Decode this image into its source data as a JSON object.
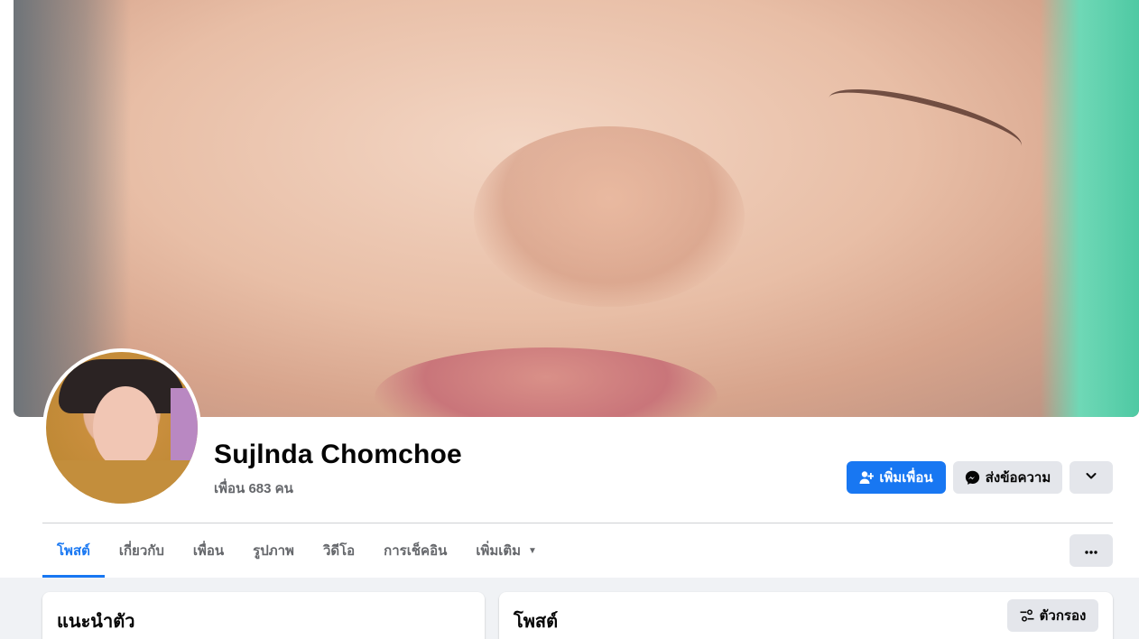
{
  "profile": {
    "name": "Sujlnda Chomchoe",
    "friends_count": "เพื่อน 683 คน"
  },
  "actions": {
    "add_friend": "เพิ่มเพื่อน",
    "message": "ส่งข้อความ"
  },
  "tabs": [
    {
      "label": "โพสต์",
      "active": true
    },
    {
      "label": "เกี่ยวกับ"
    },
    {
      "label": "เพื่อน"
    },
    {
      "label": "รูปภาพ"
    },
    {
      "label": "วิดีโอ"
    },
    {
      "label": "การเช็คอิน"
    },
    {
      "label": "เพิ่มเติม"
    }
  ],
  "intro": {
    "title": "แนะนำตัว"
  },
  "posts": {
    "title": "โพสต์",
    "filter_label": "ตัวกรอง"
  },
  "colors": {
    "accent": "#1877f2",
    "button_gray": "#e4e6eb",
    "page_bg": "#f0f2f5"
  },
  "icons": [
    "add-friend-icon",
    "messenger-icon",
    "chevron-down-icon",
    "more-dots-icon",
    "filter-icon",
    "caret-down-icon"
  ]
}
